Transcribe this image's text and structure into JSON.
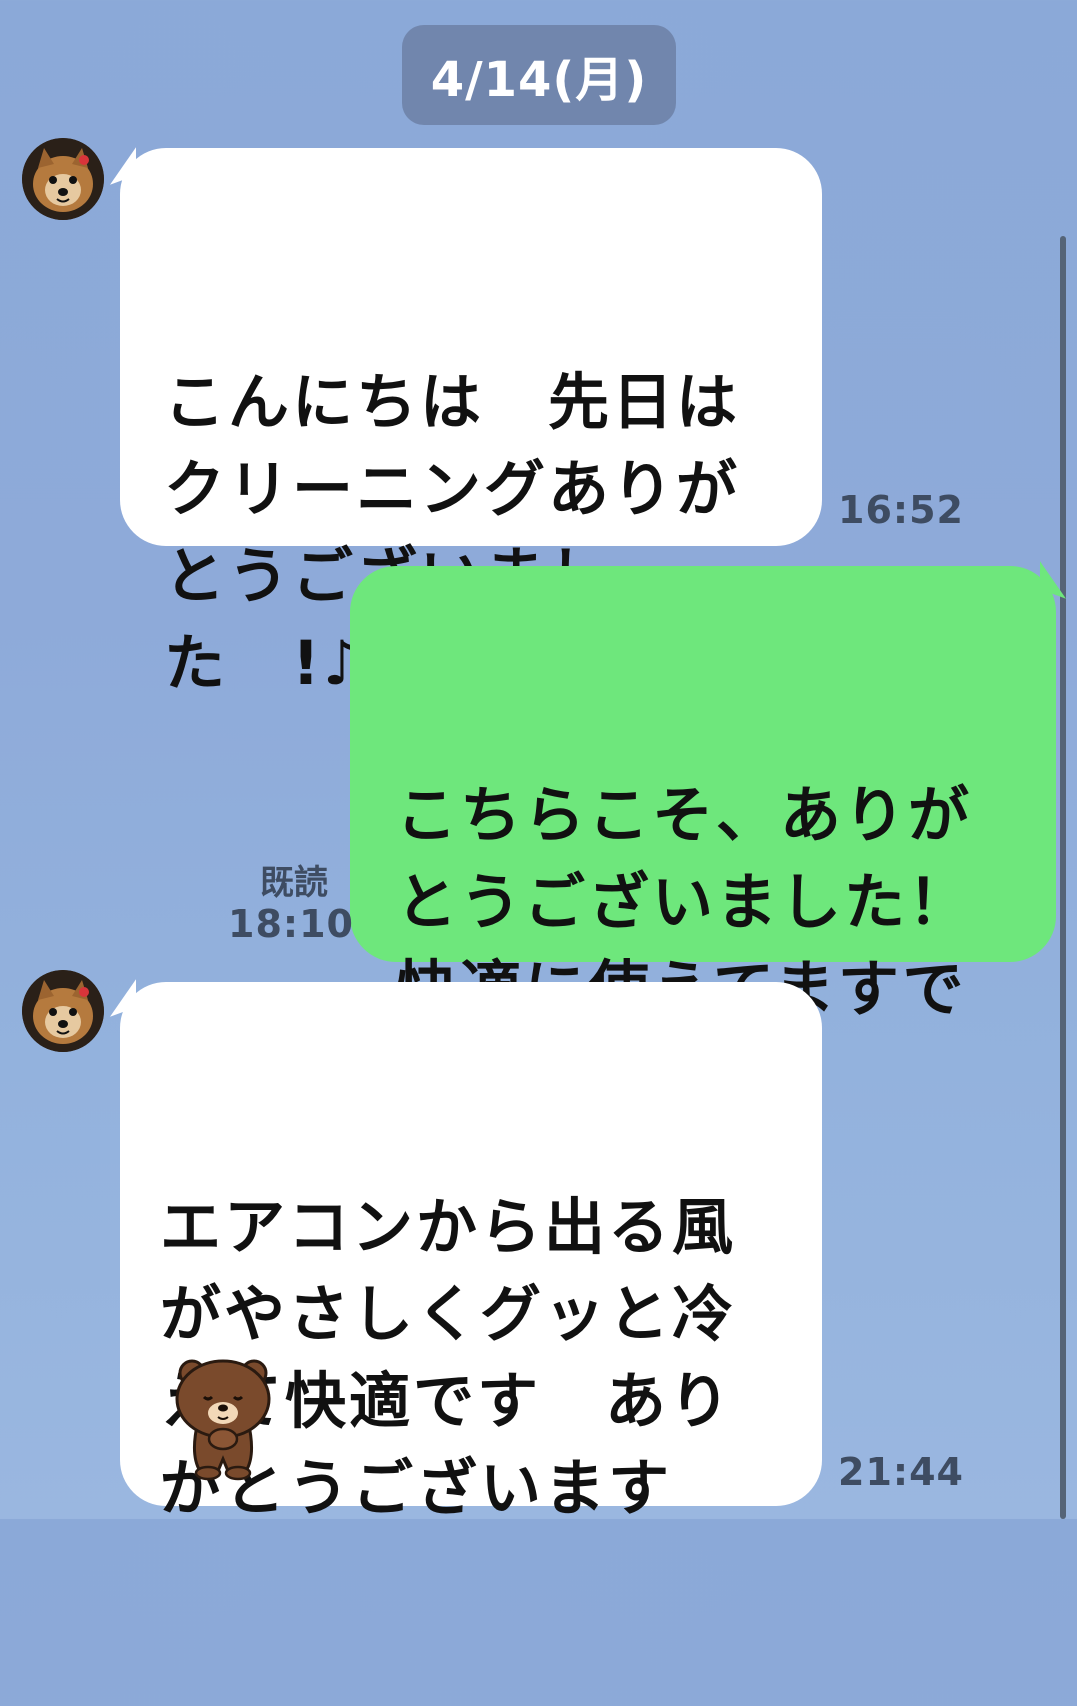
{
  "date_separator": "4/14(月)",
  "messages": [
    {
      "side": "incoming",
      "text": "こんにちは　先日は\nクリーニングありが\nとうございまし\nた　!♪",
      "time": "16:52",
      "avatar": "pomeranian-dog-avatar"
    },
    {
      "side": "outgoing",
      "text": "こちらこそ、ありが\nとうございました！\n快適に使えてますで\nしょうか？",
      "read_label": "既読",
      "time": "18:10"
    },
    {
      "side": "incoming",
      "text": "エアコンから出る風\nがやさしくグッと冷\nえて快適です　あり\nがとうございます",
      "sticker": "brown-bear-bowing-icon",
      "time": "21:44",
      "avatar": "pomeranian-dog-avatar"
    }
  ],
  "colors": {
    "background": "#8ba9d8",
    "incoming_bubble": "#ffffff",
    "outgoing_bubble": "#6ee77c",
    "date_pill": "#7186ad",
    "meta_text": "#3e4c62"
  }
}
